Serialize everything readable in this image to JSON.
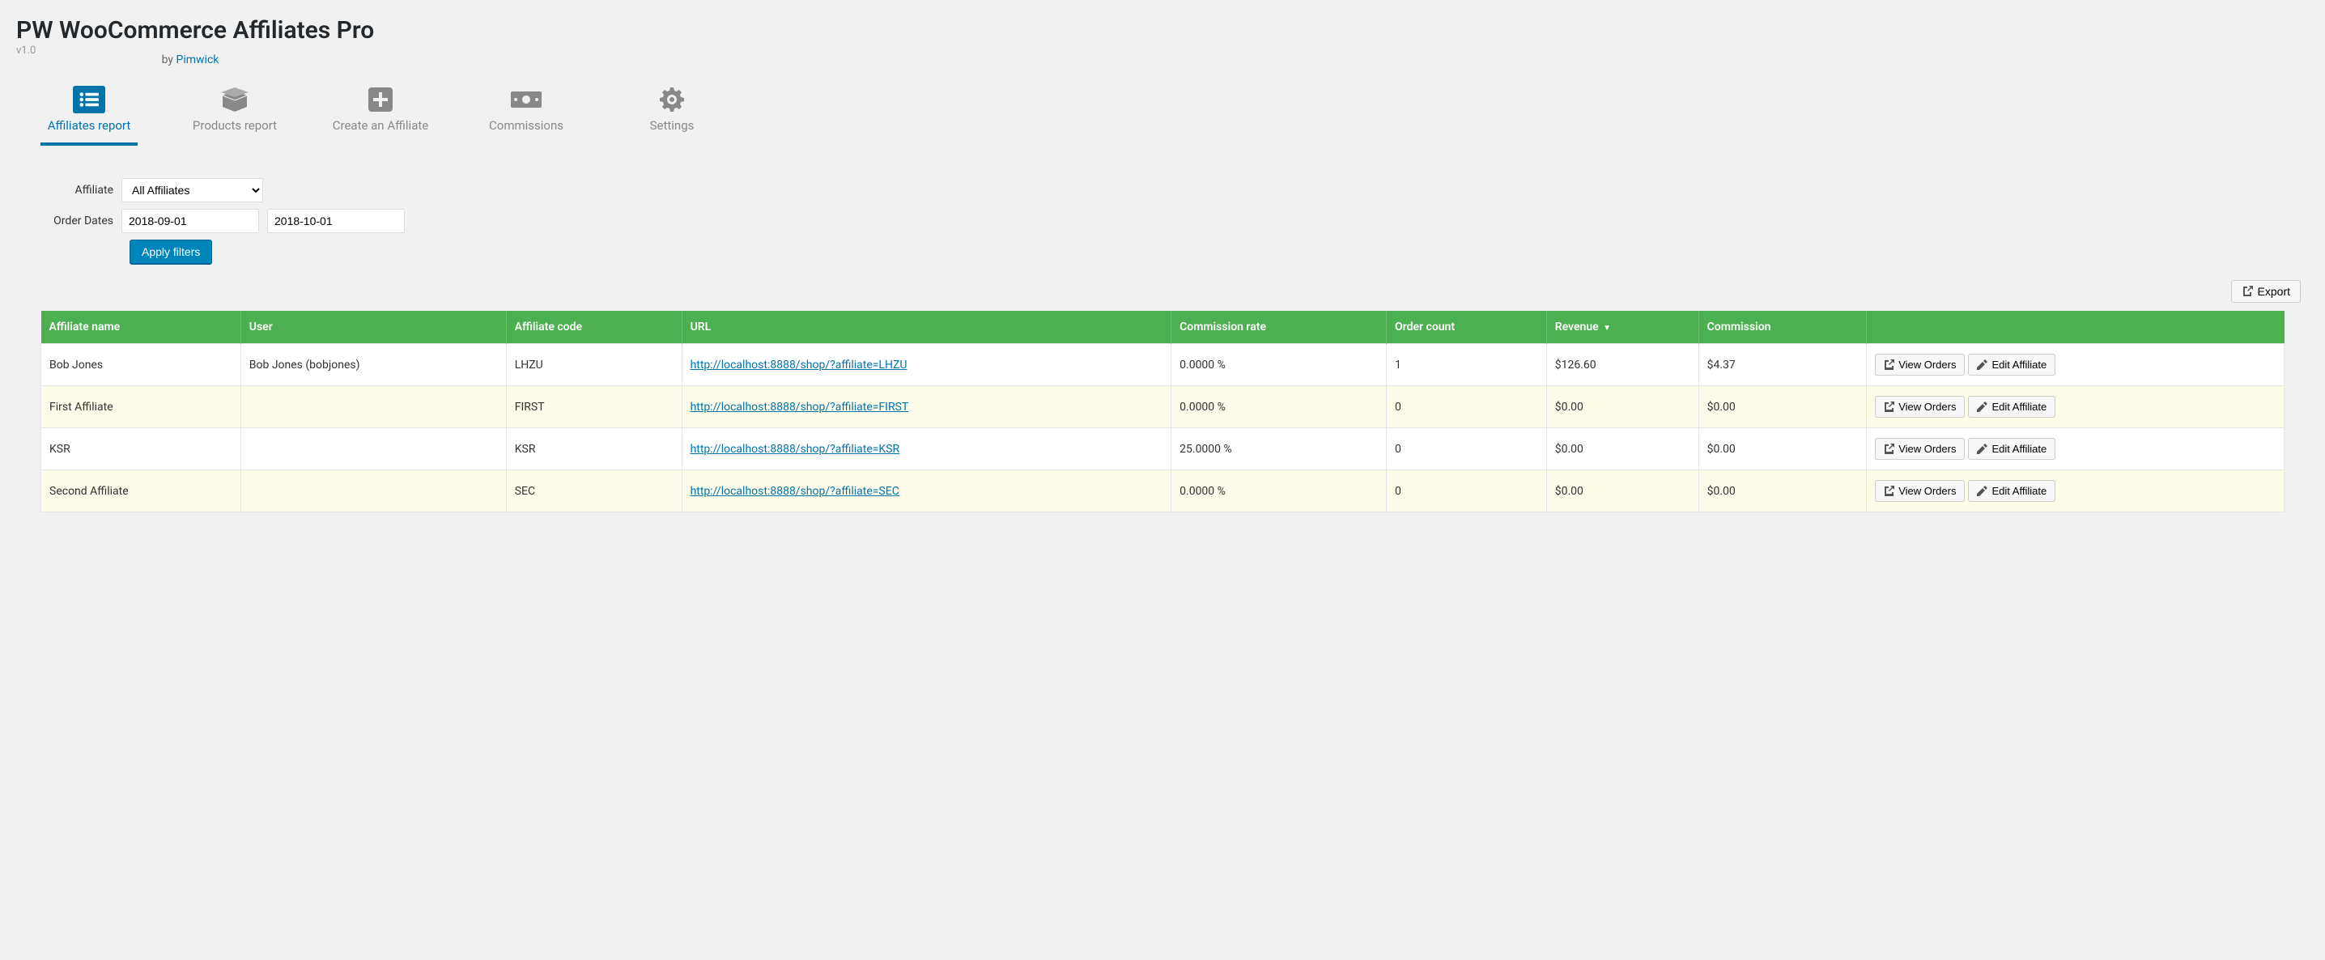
{
  "header": {
    "title": "PW WooCommerce Affiliates Pro",
    "version": "v1.0",
    "by_prefix": "by ",
    "by_link": "Pimwick"
  },
  "tabs": [
    {
      "label": "Affiliates report",
      "active": true
    },
    {
      "label": "Products report",
      "active": false
    },
    {
      "label": "Create an Affiliate",
      "active": false
    },
    {
      "label": "Commissions",
      "active": false
    },
    {
      "label": "Settings",
      "active": false
    }
  ],
  "filters": {
    "affiliate_label": "Affiliate",
    "affiliate_value": "All Affiliates",
    "dates_label": "Order Dates",
    "date_from": "2018-09-01",
    "date_to": "2018-10-01",
    "apply_label": "Apply filters"
  },
  "export_label": "Export",
  "columns": {
    "name": "Affiliate name",
    "user": "User",
    "code": "Affiliate code",
    "url": "URL",
    "rate": "Commission rate",
    "orders": "Order count",
    "revenue": "Revenue",
    "commission": "Commission"
  },
  "sort_indicator": "▼",
  "actions": {
    "view": "View Orders",
    "edit": "Edit Affiliate"
  },
  "rows": [
    {
      "name": "Bob Jones",
      "user": "Bob Jones (bobjones)",
      "code": "LHZU",
      "url": "http://localhost:8888/shop/?affiliate=LHZU",
      "rate": "0.0000 %",
      "orders": "1",
      "revenue": "$126.60",
      "commission": "$4.37"
    },
    {
      "name": "First Affiliate",
      "user": "",
      "code": "FIRST",
      "url": "http://localhost:8888/shop/?affiliate=FIRST",
      "rate": "0.0000 %",
      "orders": "0",
      "revenue": "$0.00",
      "commission": "$0.00"
    },
    {
      "name": "KSR",
      "user": "",
      "code": "KSR",
      "url": "http://localhost:8888/shop/?affiliate=KSR",
      "rate": "25.0000 %",
      "orders": "0",
      "revenue": "$0.00",
      "commission": "$0.00"
    },
    {
      "name": "Second Affiliate",
      "user": "",
      "code": "SEC",
      "url": "http://localhost:8888/shop/?affiliate=SEC",
      "rate": "0.0000 %",
      "orders": "0",
      "revenue": "$0.00",
      "commission": "$0.00"
    }
  ]
}
